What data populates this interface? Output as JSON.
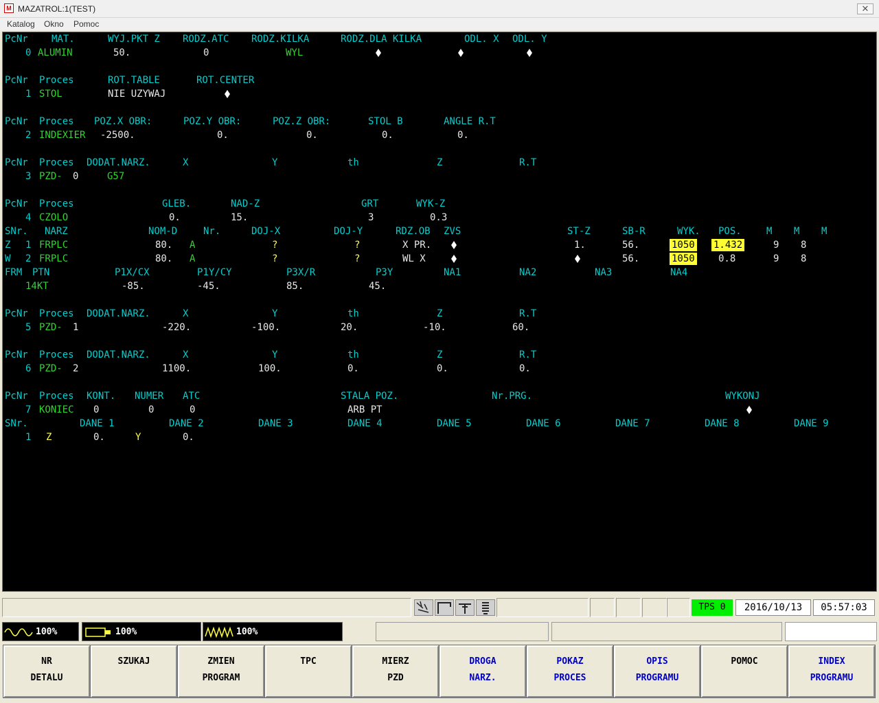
{
  "window": {
    "title": "MAZATROL:1(TEST)",
    "icon": "M",
    "close": "✕"
  },
  "menu": [
    "Katalog",
    "Okno",
    "Pomoc"
  ],
  "program": {
    "r1h": [
      "PcNr",
      "MAT.",
      "WYJ.PKT Z",
      "RODZ.ATC",
      "RODZ.KILKA",
      "RODZ.DLA KILKA",
      "ODL. X",
      "ODL. Y"
    ],
    "r1v": [
      "0",
      "ALUMIN",
      "50.",
      "0",
      "WYL"
    ],
    "r2h": [
      "PcNr",
      "Proces",
      "ROT.TABLE",
      "ROT.CENTER"
    ],
    "r2v": [
      "1",
      "STOL",
      "NIE UZYWAJ"
    ],
    "r3h": [
      "PcNr",
      "Proces",
      "POZ.X OBR:",
      "POZ.Y OBR:",
      "POZ.Z OBR:",
      "STOL B",
      "ANGLE R.T"
    ],
    "r3v": [
      "2",
      "INDEXIER",
      "-2500.",
      "0.",
      "0.",
      "0.",
      "0."
    ],
    "r4h": [
      "PcNr",
      "Proces",
      "DODAT.NARZ.",
      "X",
      "Y",
      "th",
      "Z",
      "R.T"
    ],
    "r4v": [
      "3",
      "PZD-",
      "0",
      "G57"
    ],
    "r5h": [
      "PcNr",
      "Proces",
      "GLEB.",
      "NAD-Z",
      "GRT",
      "WYK-Z"
    ],
    "r5v": [
      "4",
      "CZOLO",
      "0.",
      "15.",
      "3",
      "0.3"
    ],
    "r6h": [
      "SNr.",
      "NARZ",
      "NOM-D",
      "Nr.",
      "DOJ-X",
      "DOJ-Y",
      "RDZ.OB",
      "ZVS",
      "ST-Z",
      "SB-R",
      "WYK.",
      "POS.",
      "M",
      "M",
      "M"
    ],
    "r6a": [
      "Z",
      "1",
      "FRPLC",
      "80.",
      "A",
      "?",
      "?",
      "X PR.",
      "1.",
      "56.",
      "1050",
      "1.432",
      "9",
      "8"
    ],
    "r6b": [
      "W",
      "2",
      "FRPLC",
      "80.",
      "A",
      "?",
      "?",
      "WL X",
      "56.",
      "1050",
      "0.8",
      "9",
      "8"
    ],
    "r7h": [
      "FRM",
      "PTN",
      "P1X/CX",
      "P1Y/CY",
      "P3X/R",
      "P3Y",
      "NA1",
      "NA2",
      "NA3",
      "NA4"
    ],
    "r7v": [
      "14KT",
      "-85.",
      "-45.",
      "85.",
      "45."
    ],
    "r8h": [
      "PcNr",
      "Proces",
      "DODAT.NARZ.",
      "X",
      "Y",
      "th",
      "Z",
      "R.T"
    ],
    "r8v": [
      "5",
      "PZD-",
      "1",
      "-220.",
      "-100.",
      "20.",
      "-10.",
      "60."
    ],
    "r9h": [
      "PcNr",
      "Proces",
      "DODAT.NARZ.",
      "X",
      "Y",
      "th",
      "Z",
      "R.T"
    ],
    "r9v": [
      "6",
      "PZD-",
      "2",
      "1100.",
      "100.",
      "0.",
      "0.",
      "0."
    ],
    "r10h": [
      "PcNr",
      "Proces",
      "KONT.",
      "NUMER",
      "ATC",
      "STALA POZ.",
      "Nr.PRG.",
      "WYKONJ"
    ],
    "r10v": [
      "7",
      "KONIEC",
      "0",
      "0",
      "0",
      "ARB PT"
    ],
    "r11h": [
      "SNr.",
      "DANE 1",
      "DANE 2",
      "DANE 3",
      "DANE 4",
      "DANE 5",
      "DANE 6",
      "DANE 7",
      "DANE 8",
      "DANE 9"
    ],
    "r11v": [
      "1",
      "Z",
      "0.",
      "Y",
      "0."
    ]
  },
  "status": {
    "tool_icons": [
      "tool-break-icon",
      "spindle-icon",
      "tool-holder-icon",
      "coolant-icon"
    ],
    "tps": "TPS 0",
    "date": "2016/10/13",
    "time": "05:57:03"
  },
  "loads": [
    {
      "icon": "sine-wave-icon",
      "value": "100%"
    },
    {
      "icon": "spindle-load-icon",
      "value": "100%"
    },
    {
      "icon": "zigzag-wave-icon",
      "value": "100%"
    }
  ],
  "fkeys": [
    {
      "l1": "NR",
      "l2": "DETALU",
      "color": "#000000"
    },
    {
      "l1": "SZUKAJ",
      "l2": "",
      "color": "#000000"
    },
    {
      "l1": "ZMIEN",
      "l2": "PROGRAM",
      "color": "#000000"
    },
    {
      "l1": "TPC",
      "l2": "",
      "color": "#000000"
    },
    {
      "l1": "MIERZ",
      "l2": "PZD",
      "color": "#000000"
    },
    {
      "l1": "DROGA",
      "l2": "NARZ.",
      "color": "#0000cc"
    },
    {
      "l1": "POKAZ",
      "l2": "PROCES",
      "color": "#0000cc"
    },
    {
      "l1": "OPIS",
      "l2": "PROGRAMU",
      "color": "#0000cc"
    },
    {
      "l1": "POMOC",
      "l2": "",
      "color": "#000000"
    },
    {
      "l1": "INDEX",
      "l2": "PROGRAMU",
      "color": "#0000cc"
    }
  ],
  "colors": {
    "cyan": "#00cfcf",
    "green": "#2fd62f",
    "yellow": "#ffff44",
    "highlight": "#ffff33",
    "tps": "#00ee00"
  }
}
